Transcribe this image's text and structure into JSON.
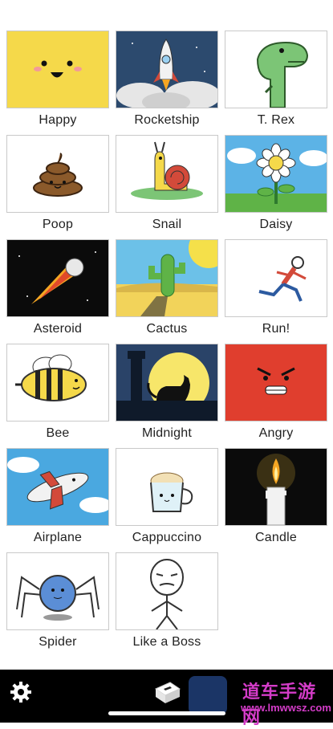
{
  "tiles": [
    {
      "label": "Happy"
    },
    {
      "label": "Rocketship"
    },
    {
      "label": "T. Rex"
    },
    {
      "label": "Poop"
    },
    {
      "label": "Snail"
    },
    {
      "label": "Daisy"
    },
    {
      "label": "Asteroid"
    },
    {
      "label": "Cactus"
    },
    {
      "label": "Run!"
    },
    {
      "label": "Bee"
    },
    {
      "label": "Midnight"
    },
    {
      "label": "Angry"
    },
    {
      "label": "Airplane"
    },
    {
      "label": "Cappuccino"
    },
    {
      "label": "Candle"
    },
    {
      "label": "Spider"
    },
    {
      "label": "Like a Boss"
    }
  ],
  "bottom_bar": {
    "settings_icon": "gear-icon",
    "book_icon": "book-icon"
  },
  "watermark": {
    "line1": "道车手游网",
    "line2": "www.lmwwsz.com"
  }
}
